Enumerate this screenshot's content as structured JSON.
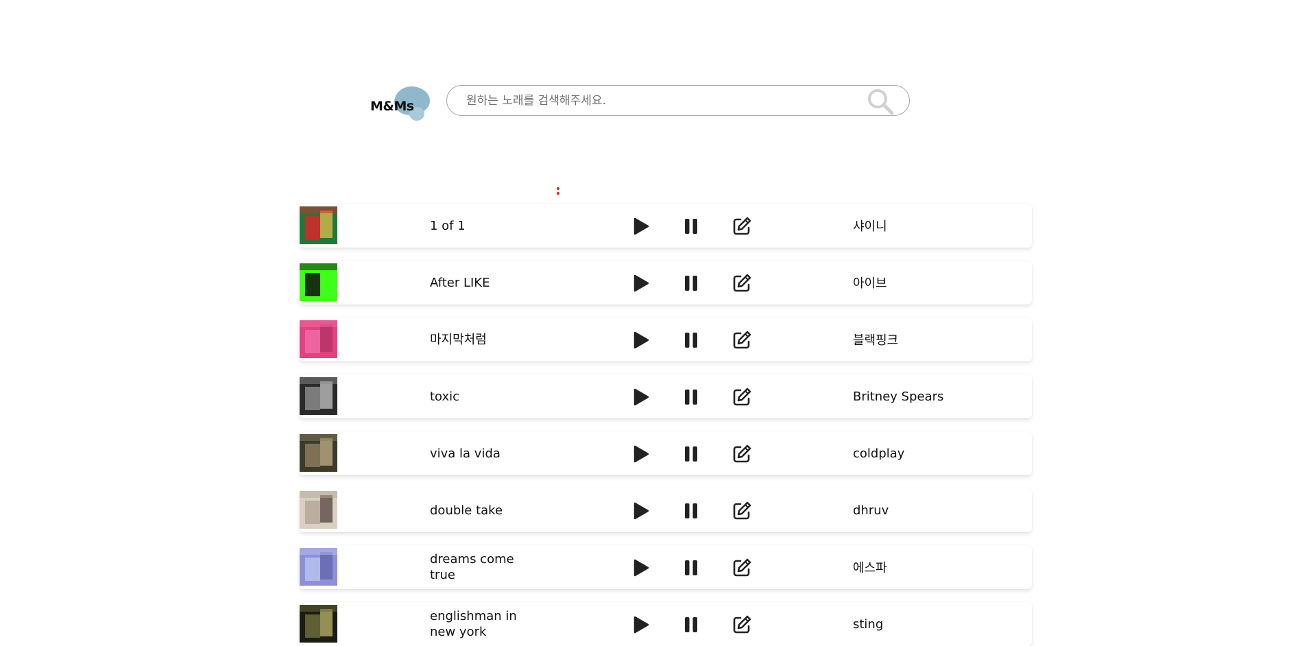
{
  "header": {
    "logo_text": "M&Ms",
    "search_placeholder": "원하는 노래를 검색해주세요.",
    "search_value": ""
  },
  "songs": [
    {
      "title": "1 of 1",
      "artist": "샤이니",
      "cover_colors": [
        "#1f7a3a",
        "#d8262b",
        "#f2c14e"
      ]
    },
    {
      "title": "After LIKE",
      "artist": "아이브",
      "cover_colors": [
        "#3dff1a",
        "#111111",
        "#3dff1a"
      ]
    },
    {
      "title": "마지막처럼",
      "artist": "블랙핑크",
      "cover_colors": [
        "#e0447f",
        "#f06aa6",
        "#b02d63"
      ]
    },
    {
      "title": "toxic",
      "artist": "Britney Spears",
      "cover_colors": [
        "#2a2a2a",
        "#8a8a8a",
        "#d0d0d0"
      ]
    },
    {
      "title": "viva la vida",
      "artist": "coldplay",
      "cover_colors": [
        "#3b3a2e",
        "#8b7a5a",
        "#c9b98a"
      ]
    },
    {
      "title": "double take",
      "artist": "dhruv",
      "cover_colors": [
        "#d9cfc2",
        "#b5a899",
        "#4a3b35"
      ]
    },
    {
      "title": "dreams come true",
      "artist": "에스파",
      "cover_colors": [
        "#8f8fd8",
        "#b7c3ee",
        "#5d5fa8"
      ]
    },
    {
      "title": "englishman in new york",
      "artist": "sting",
      "cover_colors": [
        "#1c1c14",
        "#6b6a3a",
        "#c8c070"
      ]
    }
  ],
  "icons": {
    "play": "play-icon",
    "pause": "pause-icon",
    "edit": "edit-icon",
    "search": "search-icon"
  },
  "colors": {
    "logo_blob": "#8fb8cc",
    "menu_dots": "#e02020",
    "icon": "#222222"
  }
}
